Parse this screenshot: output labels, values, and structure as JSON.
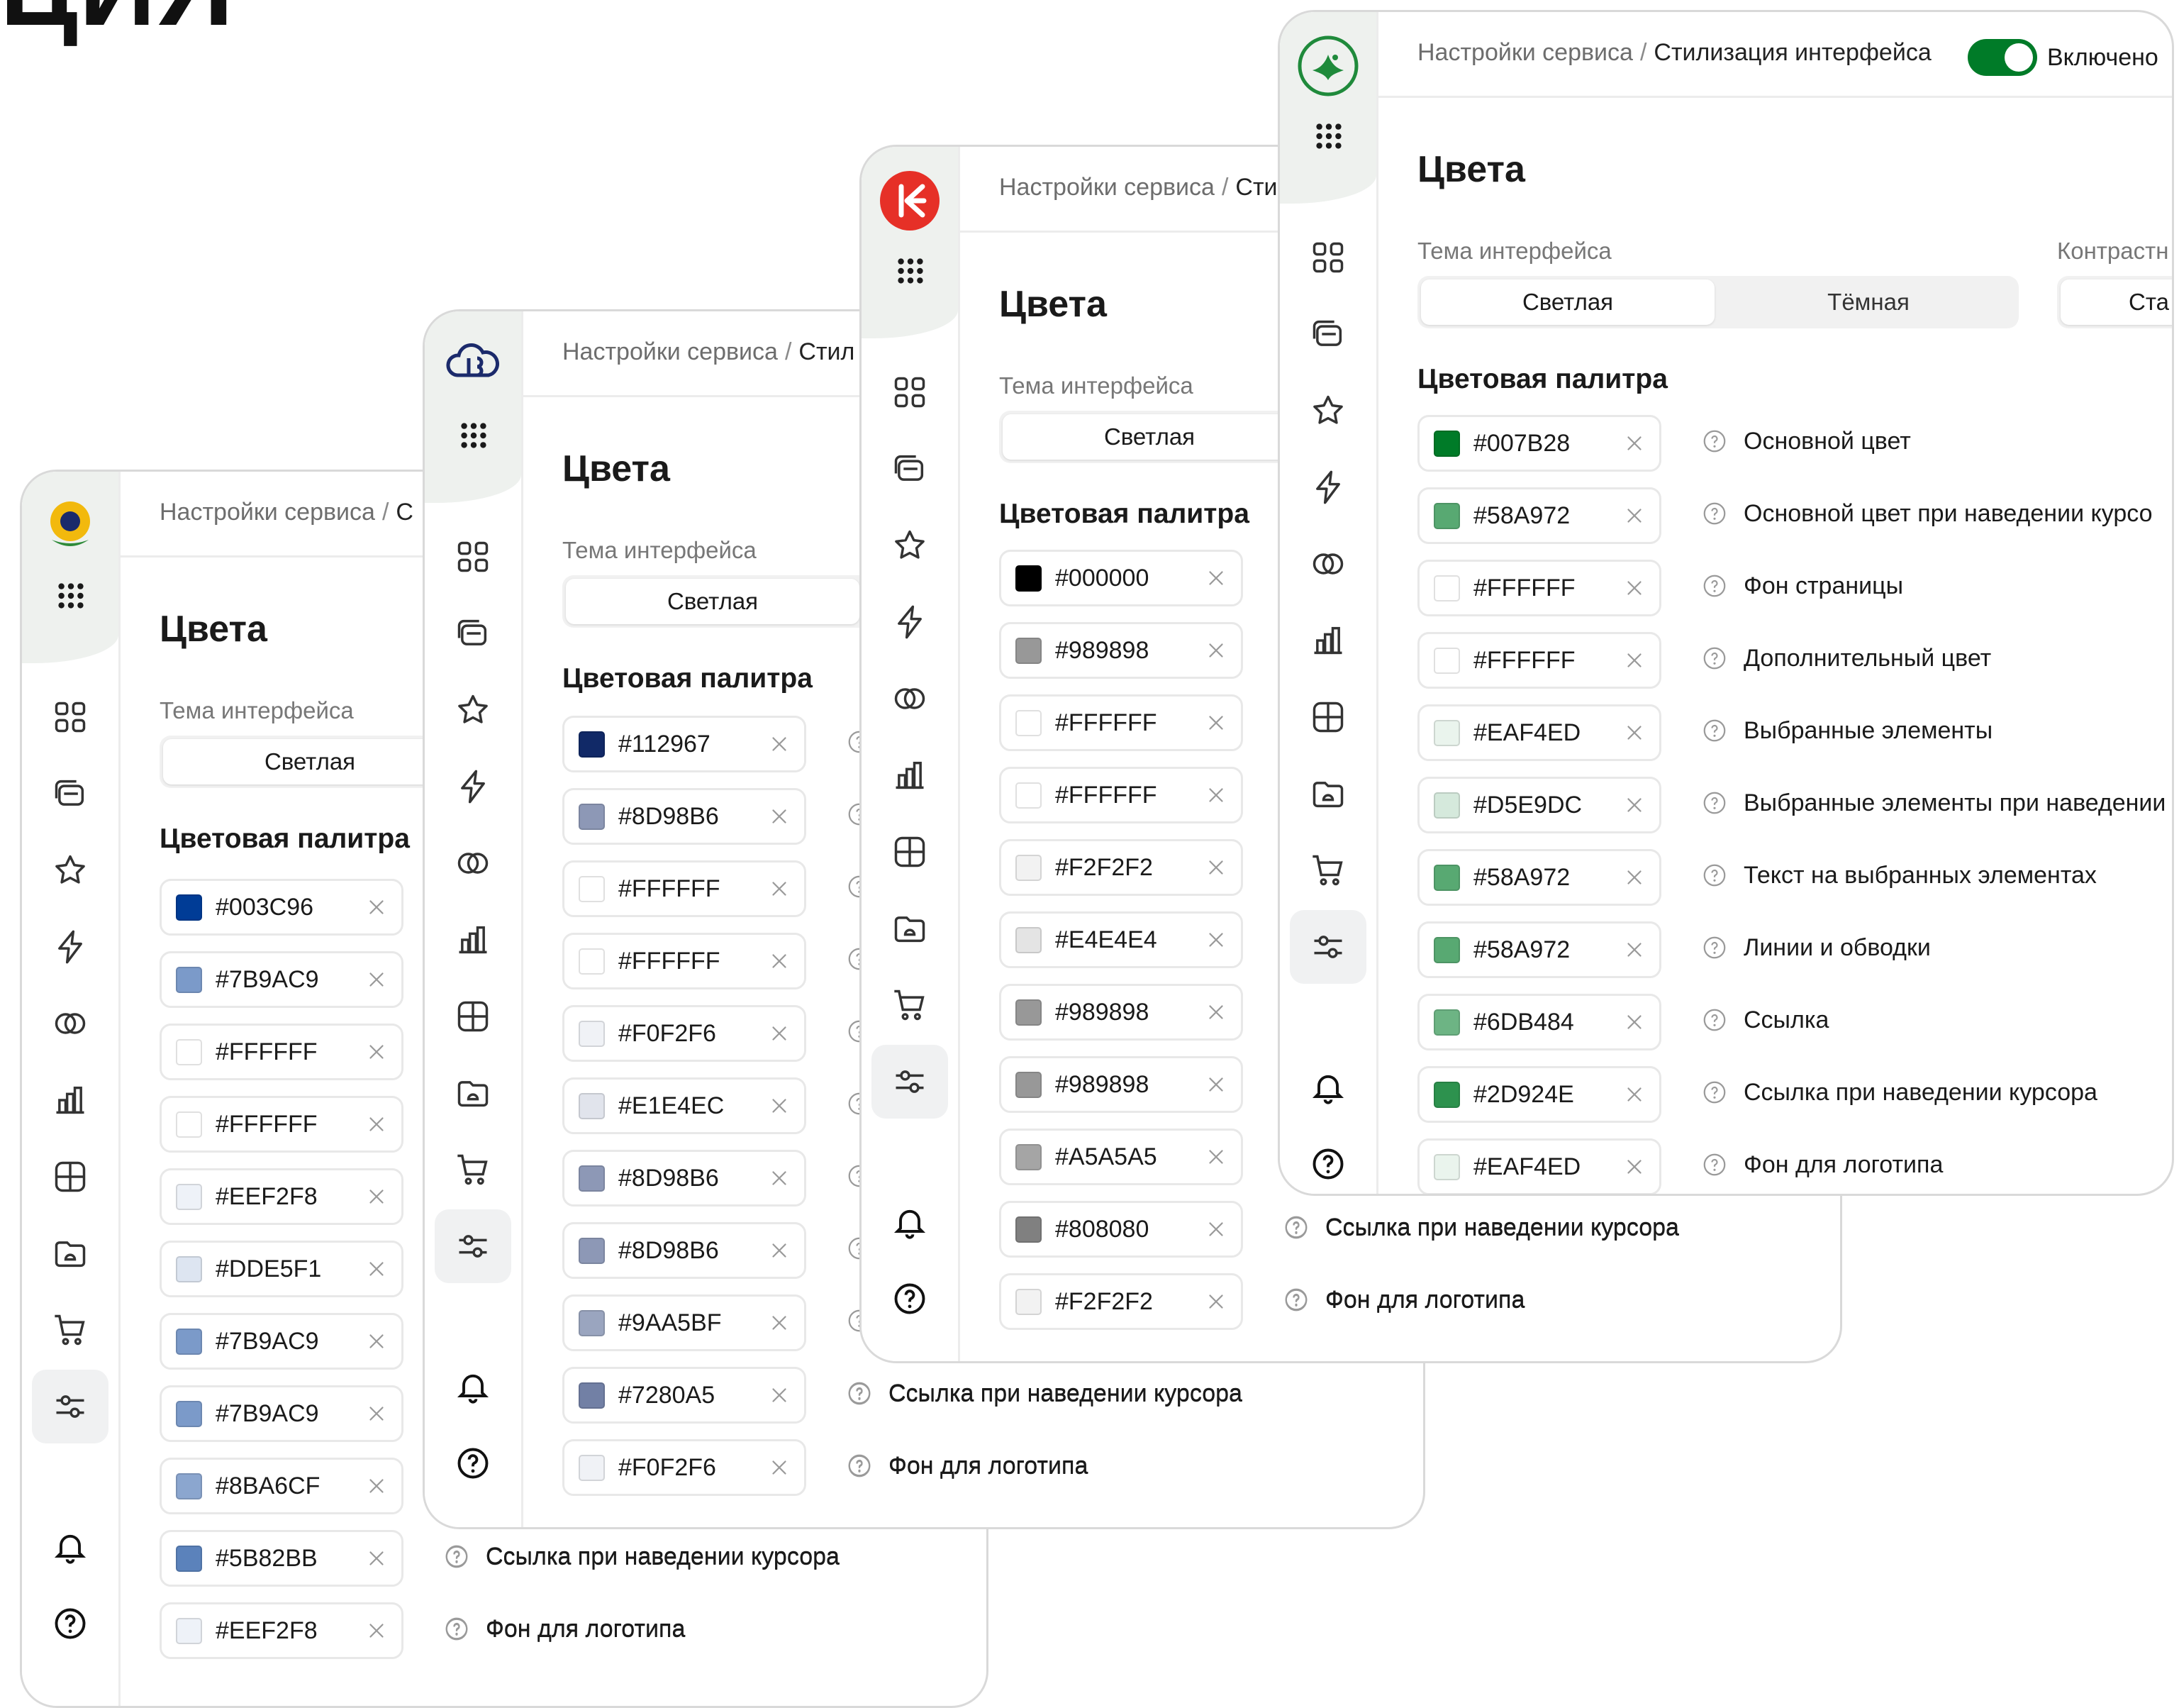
{
  "heading_fragment": "ЦИЯ",
  "breadcrumb": {
    "root": "Настройки сервиса",
    "separator": "/",
    "current": "Стилизация интерфейса",
    "cut_stubs": [
      "С",
      "Стил",
      "Сти"
    ]
  },
  "toggle": {
    "label": "Включено",
    "state": "on"
  },
  "page_title": "Цвета",
  "theme": {
    "label": "Тема интерфейса",
    "options": [
      "Светлая",
      "Тёмная"
    ],
    "selected": "Светлая"
  },
  "contrast": {
    "label": "Контрастн",
    "option": "Ста"
  },
  "palette_title": "Цветовая палитра",
  "color_roles": [
    "Основной цвет",
    "Основной цвет при наведении курсо",
    "Фон страницы",
    "Дополнительный цвет",
    "Выбранные элементы",
    "Выбранные элементы при наведении",
    "Текст на выбранных элементах",
    "Линии и обводки",
    "Ссылка",
    "Ссылка при наведении курсора",
    "Фон для логотипа"
  ],
  "panels": [
    {
      "id": "sunflower",
      "logo_color": "#f2b90d",
      "colors": [
        "#003C96",
        "#7B9AC9",
        "#FFFFFF",
        "#FFFFFF",
        "#EEF2F8",
        "#DDE5F1",
        "#7B9AC9",
        "#7B9AC9",
        "#8BA6CF",
        "#5B82BB",
        "#EEF2F8"
      ]
    },
    {
      "id": "blue-cloud",
      "logo_color": "#1b2a6b",
      "colors": [
        "#112967",
        "#8D98B6",
        "#FFFFFF",
        "#FFFFFF",
        "#F0F2F6",
        "#E1E4EC",
        "#8D98B6",
        "#8D98B6",
        "#9AA5BF",
        "#7280A5",
        "#F0F2F6"
      ]
    },
    {
      "id": "red-k",
      "logo_color": "#e63027",
      "colors": [
        "#000000",
        "#989898",
        "#FFFFFF",
        "#FFFFFF",
        "#F2F2F2",
        "#E4E4E4",
        "#989898",
        "#989898",
        "#A5A5A5",
        "#808080",
        "#F2F2F2"
      ]
    },
    {
      "id": "green-bird",
      "logo_color": "#1f8a3b",
      "colors": [
        "#007B28",
        "#58A972",
        "#FFFFFF",
        "#FFFFFF",
        "#EAF4ED",
        "#D5E9DC",
        "#58A972",
        "#58A972",
        "#6DB484",
        "#2D924E",
        "#EAF4ED"
      ]
    }
  ]
}
